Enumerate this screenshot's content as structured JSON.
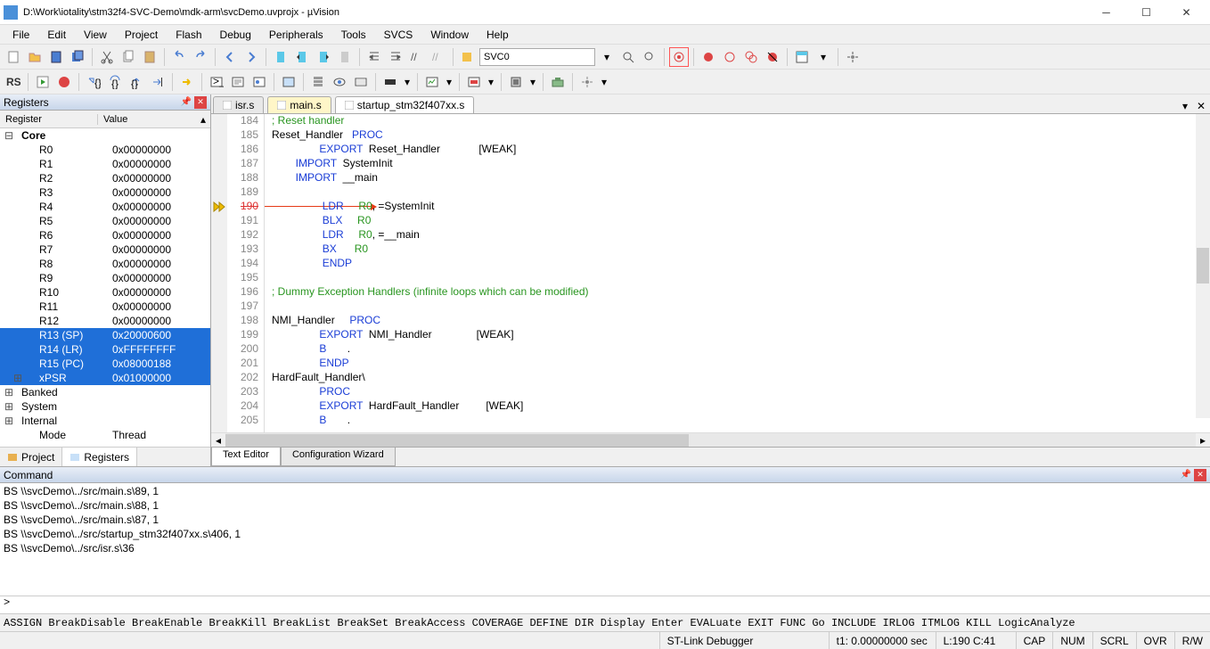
{
  "title": "D:\\Work\\iotality\\stm32f4-SVC-Demo\\mdk-arm\\svcDemo.uvprojx - µVision",
  "menu": [
    "File",
    "Edit",
    "View",
    "Project",
    "Flash",
    "Debug",
    "Peripherals",
    "Tools",
    "SVCS",
    "Window",
    "Help"
  ],
  "combo1": "SVC0",
  "panels": {
    "registers": {
      "title": "Registers",
      "cols": [
        "Register",
        "Value"
      ],
      "core": "Core",
      "rows": [
        {
          "n": "R0",
          "v": "0x00000000"
        },
        {
          "n": "R1",
          "v": "0x00000000"
        },
        {
          "n": "R2",
          "v": "0x00000000"
        },
        {
          "n": "R3",
          "v": "0x00000000"
        },
        {
          "n": "R4",
          "v": "0x00000000"
        },
        {
          "n": "R5",
          "v": "0x00000000"
        },
        {
          "n": "R6",
          "v": "0x00000000"
        },
        {
          "n": "R7",
          "v": "0x00000000"
        },
        {
          "n": "R8",
          "v": "0x00000000"
        },
        {
          "n": "R9",
          "v": "0x00000000"
        },
        {
          "n": "R10",
          "v": "0x00000000"
        },
        {
          "n": "R11",
          "v": "0x00000000"
        },
        {
          "n": "R12",
          "v": "0x00000000"
        },
        {
          "n": "R13 (SP)",
          "v": "0x20000600",
          "sel": true
        },
        {
          "n": "R14 (LR)",
          "v": "0xFFFFFFFF",
          "sel": true
        },
        {
          "n": "R15 (PC)",
          "v": "0x08000188",
          "sel": true
        },
        {
          "n": "xPSR",
          "v": "0x01000000",
          "sel": true
        }
      ],
      "groups": [
        {
          "n": "Banked"
        },
        {
          "n": "System"
        },
        {
          "n": "Internal"
        }
      ],
      "mode_lbl": "Mode",
      "mode_val": "Thread",
      "tabs": [
        "Project",
        "Registers"
      ]
    }
  },
  "editor": {
    "tabs": [
      {
        "name": "isr.s",
        "active": false
      },
      {
        "name": "main.s",
        "active": true
      },
      {
        "name": "startup_stm32f407xx.s",
        "active": false
      }
    ],
    "bottom_tabs": [
      "Text Editor",
      "Configuration Wizard"
    ],
    "lines": [
      {
        "n": 184,
        "t": "; Reset handler",
        "cm": true
      },
      {
        "n": 185,
        "t": "Reset_Handler   PROC",
        "kw": "PROC"
      },
      {
        "n": 186,
        "t": "                EXPORT  Reset_Handler             [WEAK]",
        "kw": "EXPORT"
      },
      {
        "n": 187,
        "t": "        IMPORT  SystemInit",
        "kw": "IMPORT"
      },
      {
        "n": 188,
        "t": "        IMPORT  __main",
        "kw": "IMPORT"
      },
      {
        "n": 189,
        "t": ""
      },
      {
        "n": 190,
        "t": "                 LDR     R0, =SystemInit",
        "kw": "LDR",
        "r": "R0",
        "brk": true,
        "strike": true
      },
      {
        "n": 191,
        "t": "                 BLX     R0",
        "kw": "BLX",
        "r": "R0"
      },
      {
        "n": 192,
        "t": "                 LDR     R0, =__main",
        "kw": "LDR",
        "r": "R0"
      },
      {
        "n": 193,
        "t": "                 BX      R0",
        "kw": "BX",
        "r": "R0"
      },
      {
        "n": 194,
        "t": "                 ENDP",
        "kw": "ENDP"
      },
      {
        "n": 195,
        "t": ""
      },
      {
        "n": 196,
        "t": "; Dummy Exception Handlers (infinite loops which can be modified)",
        "cm": true
      },
      {
        "n": 197,
        "t": ""
      },
      {
        "n": 198,
        "t": "NMI_Handler     PROC",
        "kw": "PROC"
      },
      {
        "n": 199,
        "t": "                EXPORT  NMI_Handler               [WEAK]",
        "kw": "EXPORT"
      },
      {
        "n": 200,
        "t": "                B       .",
        "kw": "B"
      },
      {
        "n": 201,
        "t": "                ENDP",
        "kw": "ENDP"
      },
      {
        "n": 202,
        "t": "HardFault_Handler\\"
      },
      {
        "n": 203,
        "t": "                PROC",
        "kw": "PROC"
      },
      {
        "n": 204,
        "t": "                EXPORT  HardFault_Handler         [WEAK]",
        "kw": "EXPORT"
      },
      {
        "n": 205,
        "t": "                B       .",
        "kw": "B"
      }
    ]
  },
  "command": {
    "title": "Command",
    "lines": [
      "BS \\\\svcDemo\\../src/main.s\\89, 1",
      "BS \\\\svcDemo\\../src/main.s\\88, 1",
      "BS \\\\svcDemo\\../src/main.s\\87, 1",
      "BS \\\\svcDemo\\../src/startup_stm32f407xx.s\\406, 1",
      "BS \\\\svcDemo\\../src/isr.s\\36"
    ],
    "prompt": ">"
  },
  "hints": "ASSIGN BreakDisable BreakEnable BreakKill BreakList BreakSet BreakAccess COVERAGE DEFINE DIR Display Enter EVALuate EXIT FUNC Go INCLUDE IRLOG ITMLOG KILL LogicAnalyze",
  "status": {
    "debugger": "ST-Link Debugger",
    "time": "t1: 0.00000000 sec",
    "pos": "L:190 C:41",
    "flags": [
      "CAP",
      "NUM",
      "SCRL",
      "OVR",
      "R/W"
    ]
  }
}
